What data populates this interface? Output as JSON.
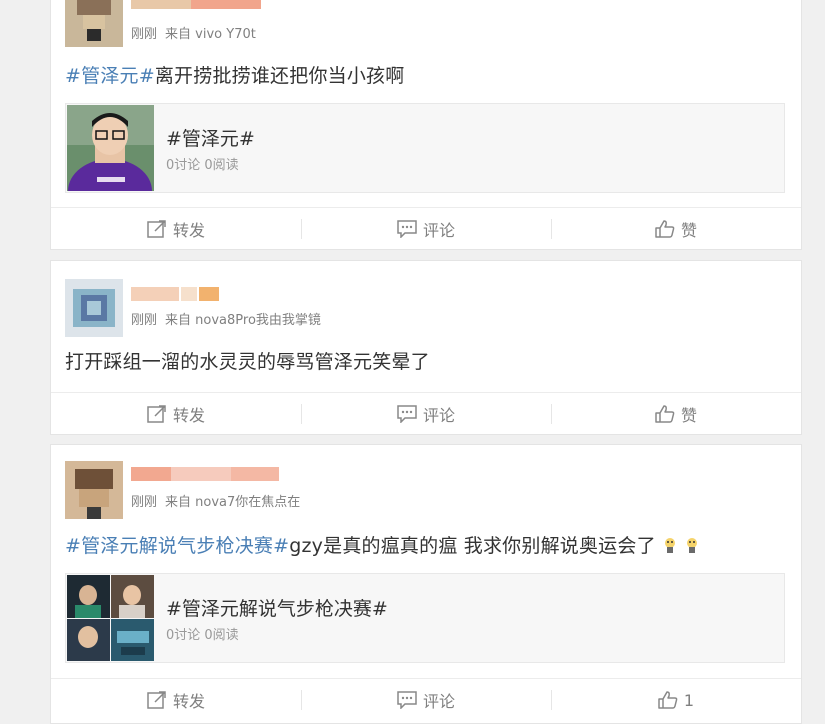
{
  "posts": [
    {
      "meta_time": "刚刚",
      "meta_source_prefix": "来自",
      "meta_source": "vivo Y70t",
      "text_hashtag": "#管泽元#",
      "text_body": "离开捞批捞谁还把你当小孩啊",
      "topic": {
        "title": "#管泽元#",
        "stats": "0讨论 0阅读"
      },
      "actions": {
        "repost": "转发",
        "comment": "评论",
        "like": "赞"
      }
    },
    {
      "meta_time": "刚刚",
      "meta_source_prefix": "来自",
      "meta_source": "nova8Pro我由我掌镜",
      "text_body": "打开踩组一溜的水灵灵的辱骂管泽元笑晕了",
      "actions": {
        "repost": "转发",
        "comment": "评论",
        "like": "赞"
      }
    },
    {
      "meta_time": "刚刚",
      "meta_source_prefix": "来自",
      "meta_source": "nova7你在焦点在",
      "text_hashtag": "#管泽元解说气步枪决赛#",
      "text_body": "gzy是真的瘟真的瘟 我求你别解说奥运会了",
      "topic": {
        "title": "#管泽元解说气步枪决赛#",
        "stats": "0讨论 0阅读"
      },
      "actions": {
        "repost": "转发",
        "comment": "评论",
        "like": "1"
      }
    }
  ],
  "colors": {
    "hashtag": "#4a7fb5",
    "meta": "#808080",
    "background": "#f0f0f0"
  }
}
